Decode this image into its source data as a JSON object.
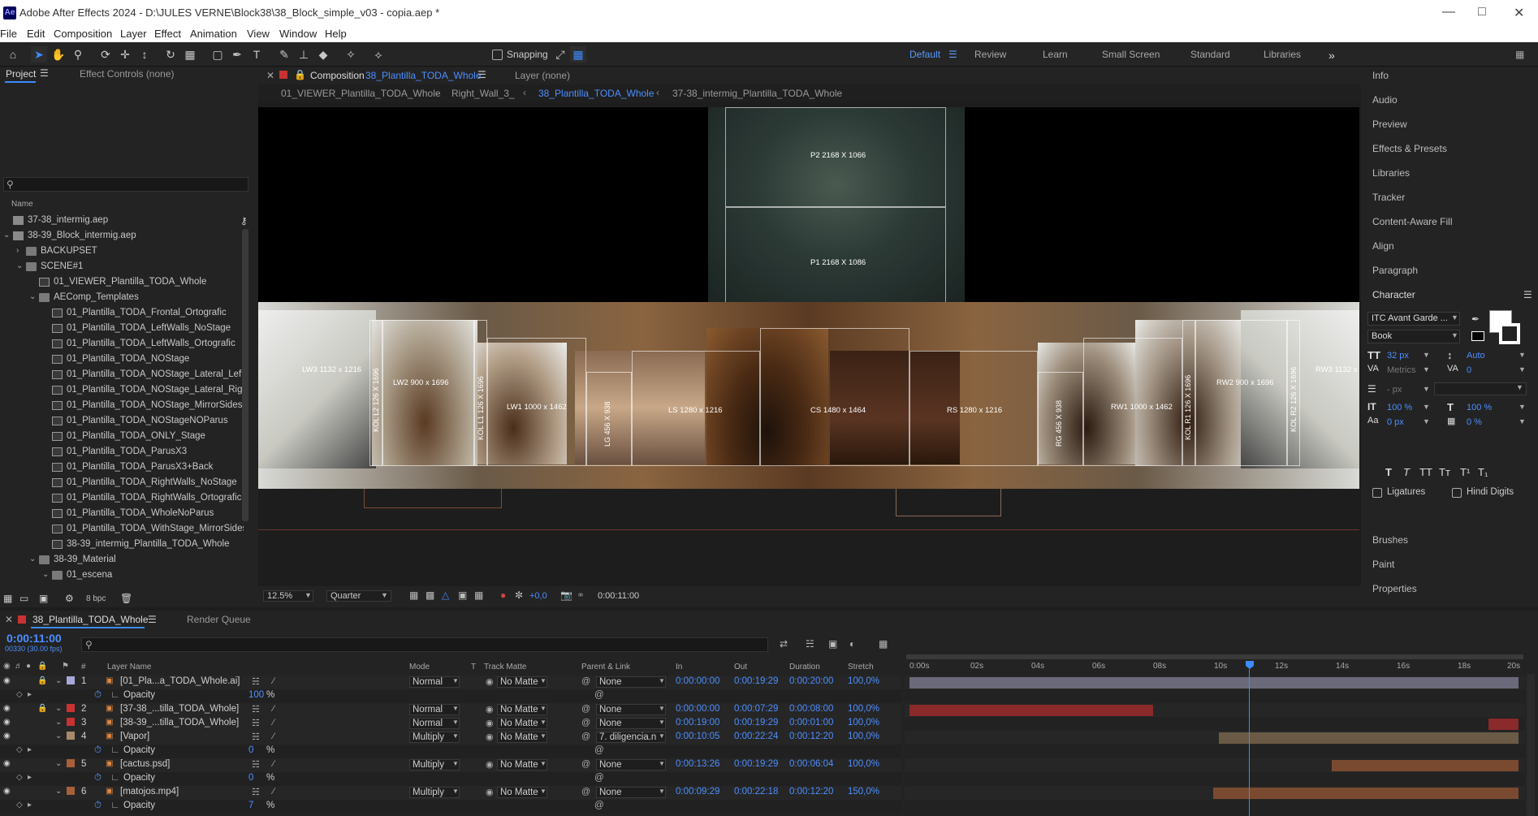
{
  "title_bar": {
    "logo": "Ae",
    "title": "Adobe After Effects 2024 - D:\\JULES VERNE\\Block38\\38_Block_simple_v03 - copia.aep *"
  },
  "menu": [
    "File",
    "Edit",
    "Composition",
    "Layer",
    "Effect",
    "Animation",
    "View",
    "Window",
    "Help"
  ],
  "toolbar": {
    "snapping": "Snapping",
    "workspaces": [
      "Default",
      "Review",
      "Learn",
      "Small Screen",
      "Standard",
      "Libraries"
    ],
    "active_workspace": "Default"
  },
  "project": {
    "tab_project": "Project",
    "tab_effect_controls": "Effect Controls (none)",
    "search_placeholder": "",
    "col_name": "Name",
    "bpc": "8 bpc",
    "items": [
      {
        "name": "37-38_intermig.aep",
        "type": "aep",
        "indent": 0,
        "arrow": ""
      },
      {
        "name": "38-39_Block_intermig.aep",
        "type": "aep",
        "indent": 0,
        "arrow": "v"
      },
      {
        "name": "BACKUPSET",
        "type": "folder",
        "indent": 1,
        "arrow": ">"
      },
      {
        "name": "SCENE#1",
        "type": "folder",
        "indent": 1,
        "arrow": "v"
      },
      {
        "name": "01_VIEWER_Plantilla_TODA_Whole",
        "type": "comp",
        "indent": 2,
        "arrow": ""
      },
      {
        "name": "AEComp_Templates",
        "type": "folder",
        "indent": 2,
        "arrow": "v"
      },
      {
        "name": "01_Plantilla_TODA_Frontal_Ortografic",
        "type": "comp",
        "indent": 3,
        "arrow": ""
      },
      {
        "name": "01_Plantilla_TODA_LeftWalls_NoStage",
        "type": "comp",
        "indent": 3,
        "arrow": ""
      },
      {
        "name": "01_Plantilla_TODA_LeftWalls_Ortografic",
        "type": "comp",
        "indent": 3,
        "arrow": ""
      },
      {
        "name": "01_Plantilla_TODA_NOStage",
        "type": "comp",
        "indent": 3,
        "arrow": ""
      },
      {
        "name": "01_Plantilla_TODA_NOStage_Lateral_Left",
        "type": "comp",
        "indent": 3,
        "arrow": ""
      },
      {
        "name": "01_Plantilla_TODA_NOStage_Lateral_Right",
        "type": "comp",
        "indent": 3,
        "arrow": ""
      },
      {
        "name": "01_Plantilla_TODA_NOStage_MirrorSides",
        "type": "comp",
        "indent": 3,
        "arrow": ""
      },
      {
        "name": "01_Plantilla_TODA_NOStageNOParus",
        "type": "comp",
        "indent": 3,
        "arrow": ""
      },
      {
        "name": "01_Plantilla_TODA_ONLY_Stage",
        "type": "comp",
        "indent": 3,
        "arrow": ""
      },
      {
        "name": "01_Plantilla_TODA_ParusX3",
        "type": "comp",
        "indent": 3,
        "arrow": ""
      },
      {
        "name": "01_Plantilla_TODA_ParusX3+Back",
        "type": "comp",
        "indent": 3,
        "arrow": ""
      },
      {
        "name": "01_Plantilla_TODA_RightWalls_NoStage",
        "type": "comp",
        "indent": 3,
        "arrow": ""
      },
      {
        "name": "01_Plantilla_TODA_RightWalls_Ortografic",
        "type": "comp",
        "indent": 3,
        "arrow": ""
      },
      {
        "name": "01_Plantilla_TODA_WholeNoParus",
        "type": "comp",
        "indent": 3,
        "arrow": ""
      },
      {
        "name": "01_Plantilla_TODA_WithStage_MirrorSides",
        "type": "comp",
        "indent": 3,
        "arrow": ""
      },
      {
        "name": "38-39_intermig_Plantilla_TODA_Whole",
        "type": "comp",
        "indent": 3,
        "arrow": ""
      },
      {
        "name": "38-39_Material",
        "type": "folder",
        "indent": 2,
        "arrow": "v"
      },
      {
        "name": "01_escena",
        "type": "folder",
        "indent": 3,
        "arrow": "v"
      }
    ]
  },
  "viewer": {
    "tab_comp_prefix": "Composition",
    "tab_comp_name": "38_Plantilla_TODA_Whole",
    "tab_layer": "Layer (none)",
    "breadcrumbs": [
      "01_VIEWER_Plantilla_TODA_Whole",
      "Right_Wall_3_",
      "38_Plantilla_TODA_Whole",
      "37-38_intermig_Plantilla_TODA_Whole"
    ],
    "active_breadcrumb": "38_Plantilla_TODA_Whole",
    "zoom": "12.5%",
    "resolution": "Quarter",
    "exposure": "+0,0",
    "timecode": "0:00:11:00",
    "surfaces": {
      "p2": "P2 2168 X 1066",
      "p1": "P1 2168 X 1086",
      "lw3": "LW3 1132 x 1216",
      "kol_l2": "KOL L2 126 X 1696",
      "lw2": "LW2 900 x 1696",
      "kol_l1": "KOL L1 126 X 1696",
      "lw1": "LW1 1000 x 1462",
      "lg": "LG 456 X 938",
      "ls": "LS 1280 x 1216",
      "cs": "CS 1480 x 1464",
      "rs": "RS 1280 x 1216",
      "rg": "RG 456 X 938",
      "rw1": "RW1 1000 x 1462",
      "kol_r1": "KOL R1 126 X 1696",
      "rw2": "RW2 900 x 1696",
      "kol_r2": "KOL R2 126 X 1696",
      "rw3": "RW3 1132 x"
    }
  },
  "right_panel": {
    "items": [
      "Info",
      "Audio",
      "Preview",
      "Effects & Presets",
      "Libraries",
      "Tracker",
      "Content-Aware Fill",
      "Align",
      "Paragraph"
    ],
    "character": {
      "title": "Character",
      "font": "ITC Avant Garde ...",
      "style": "Book",
      "size": "32 px",
      "leading": "Auto",
      "kerning": "Metrics",
      "tracking": "0",
      "stroke": "- px",
      "vscale": "100 %",
      "hscale": "100 %",
      "baseline": "0 px",
      "tsume": "0 %",
      "ligatures": "Ligatures",
      "hindi": "Hindi Digits"
    },
    "bottom_items": [
      "Brushes",
      "Paint",
      "Properties"
    ]
  },
  "timeline": {
    "tab": "38_Plantilla_TODA_Whole",
    "render_queue": "Render Queue",
    "timecode": "0:00:11:00",
    "frames": "00330 (30.00 fps)",
    "headers": {
      "num": "#",
      "layer_name": "Layer Name",
      "mode": "Mode",
      "t": "T",
      "track_matte": "Track Matte",
      "parent": "Parent & Link",
      "in": "In",
      "out": "Out",
      "duration": "Duration",
      "stretch": "Stretch"
    },
    "ruler": [
      "0:00s",
      "02s",
      "04s",
      "06s",
      "08s",
      "10s",
      "12s",
      "14s",
      "16s",
      "18s",
      "20s"
    ],
    "rows": [
      {
        "kind": "layer",
        "num": "1",
        "name": "[01_Pla...a_TODA_Whole.ai]",
        "mode": "Normal",
        "matte": "No Matte",
        "parent": "None",
        "in": "0:00:00:00",
        "out": "0:00:19:29",
        "dur": "0:00:20:00",
        "stretch": "100,0%",
        "label": "#a8a8d8"
      },
      {
        "kind": "prop",
        "name": "Opacity",
        "value": "100",
        "unit": "%"
      },
      {
        "kind": "layer",
        "num": "2",
        "name": "[37-38_...tilla_TODA_Whole]",
        "mode": "Normal",
        "matte": "No Matte",
        "parent": "None",
        "in": "0:00:00:00",
        "out": "0:00:07:29",
        "dur": "0:00:08:00",
        "stretch": "100,0%",
        "label": "#c83232"
      },
      {
        "kind": "layer",
        "num": "3",
        "name": "[38-39_...tilla_TODA_Whole]",
        "mode": "Normal",
        "matte": "No Matte",
        "parent": "None",
        "in": "0:00:19:00",
        "out": "0:00:19:29",
        "dur": "0:00:01:00",
        "stretch": "100,0%",
        "label": "#c83232"
      },
      {
        "kind": "layer",
        "num": "4",
        "name": "[Vapor]",
        "mode": "Multiply",
        "matte": "No Matte",
        "parent": "7. diligencia.n",
        "in": "0:00:10:05",
        "out": "0:00:22:24",
        "dur": "0:00:12:20",
        "stretch": "100,0%",
        "label": "#a88a6a"
      },
      {
        "kind": "prop",
        "name": "Opacity",
        "value": "0",
        "unit": "%"
      },
      {
        "kind": "layer",
        "num": "5",
        "name": "[cactus.psd]",
        "mode": "Multiply",
        "matte": "No Matte",
        "parent": "None",
        "in": "0:00:13:26",
        "out": "0:00:19:29",
        "dur": "0:00:06:04",
        "stretch": "100,0%",
        "label": "#a8603a"
      },
      {
        "kind": "prop",
        "name": "Opacity",
        "value": "0",
        "unit": "%"
      },
      {
        "kind": "layer",
        "num": "6",
        "name": "[matojos.mp4]",
        "mode": "Multiply",
        "matte": "No Matte",
        "parent": "None",
        "in": "0:00:09:29",
        "out": "0:00:22:18",
        "dur": "0:00:12:20",
        "stretch": "150,0%",
        "label": "#a8603a"
      },
      {
        "kind": "prop",
        "name": "Opacity",
        "value": "7",
        "unit": "%"
      }
    ]
  },
  "colors": {
    "accent": "#4d8fff",
    "playhead": "#3d8bff",
    "bg": "#1d1d1d",
    "panel": "#232323"
  }
}
